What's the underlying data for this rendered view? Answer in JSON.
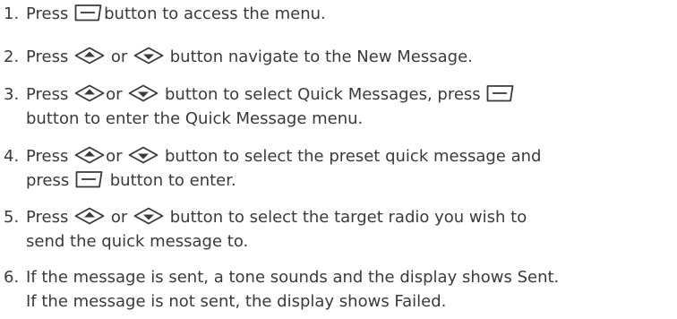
{
  "steps": [
    {
      "num": "1.",
      "a": "Press",
      "b": "button to access the menu."
    },
    {
      "num": "2.",
      "a": "Press",
      "b": "or",
      "c": "button navigate to the New Message."
    },
    {
      "num": "3.",
      "a": "Press",
      "b": "or",
      "c": "button to select Quick Messages, press",
      "d": "button to enter the Quick Message menu."
    },
    {
      "num": "4.",
      "a": "Press",
      "b": "or",
      "c": "button to select the preset quick message and",
      "d": "press",
      "e": "button to enter."
    },
    {
      "num": "5.",
      "a": "Press",
      "b": "or",
      "c": "button to select the target radio you wish to",
      "d": "send the quick message to."
    },
    {
      "num": "6.",
      "a": "If the message is sent, a tone sounds and the display shows Sent.",
      "b": "If the message is not sent, the display shows Failed."
    }
  ],
  "icons": {
    "menu": "menu-ok-key-icon",
    "up": "up-key-icon",
    "down": "down-key-icon"
  }
}
